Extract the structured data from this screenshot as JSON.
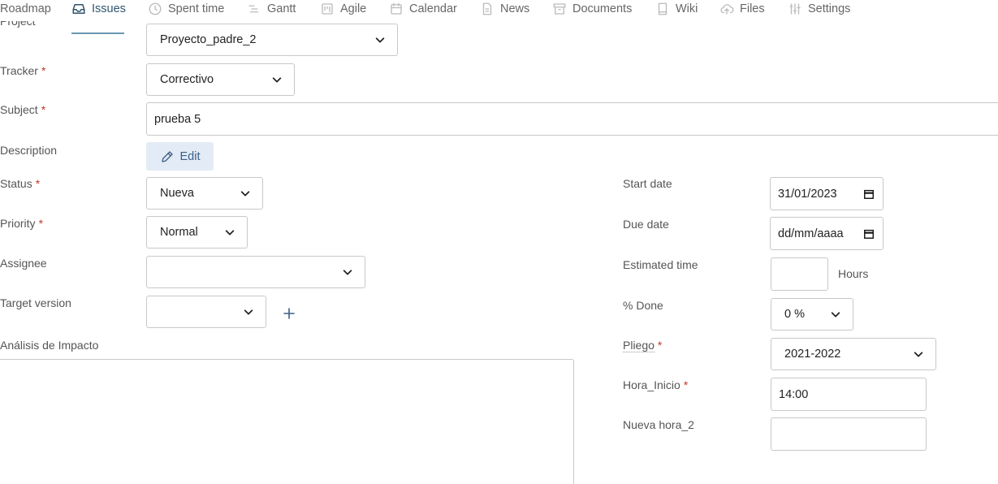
{
  "nav": {
    "items": [
      {
        "label": "Roadmap",
        "icon": "roadmap-icon"
      },
      {
        "label": "Issues",
        "icon": "inbox-icon"
      },
      {
        "label": "Spent time",
        "icon": "clock-icon"
      },
      {
        "label": "Gantt",
        "icon": "gantt-icon"
      },
      {
        "label": "Agile",
        "icon": "board-icon"
      },
      {
        "label": "Calendar",
        "icon": "calendar-icon"
      },
      {
        "label": "News",
        "icon": "news-icon"
      },
      {
        "label": "Documents",
        "icon": "archive-icon"
      },
      {
        "label": "Wiki",
        "icon": "book-icon"
      },
      {
        "label": "Files",
        "icon": "cloud-upload-icon"
      },
      {
        "label": "Settings",
        "icon": "sliders-icon"
      }
    ],
    "active": "Issues"
  },
  "form": {
    "project": {
      "label": "Project",
      "value": "Proyecto_padre_2"
    },
    "tracker": {
      "label": "Tracker",
      "value": "Correctivo"
    },
    "subject": {
      "label": "Subject",
      "value": "prueba 5"
    },
    "description": {
      "label": "Description",
      "edit_label": "Edit"
    },
    "status": {
      "label": "Status",
      "value": "Nueva"
    },
    "priority": {
      "label": "Priority",
      "value": "Normal"
    },
    "assignee": {
      "label": "Assignee",
      "value": ""
    },
    "target_version": {
      "label": "Target version",
      "value": ""
    },
    "analisis": {
      "label": "Análisis de Impacto",
      "value": ""
    },
    "start_date": {
      "label": "Start date",
      "value": "31/01/2023"
    },
    "due_date": {
      "label": "Due date",
      "value": "dd/mm/aaaa"
    },
    "estimated_time": {
      "label": "Estimated time",
      "value": "",
      "unit": "Hours"
    },
    "done": {
      "label": "% Done",
      "value": "0 %"
    },
    "pliego": {
      "label": "Pliego",
      "value": "2021-2022"
    },
    "hora_inicio": {
      "label": "Hora_Inicio",
      "value": "14:00"
    },
    "nueva_hora_2": {
      "label": "Nueva hora_2",
      "value": ""
    },
    "required_mark": "*"
  },
  "colors": {
    "accent": "#30556e",
    "required": "#c0392b",
    "edit_bg": "#e3ebf6",
    "border": "#c8c8c8"
  }
}
